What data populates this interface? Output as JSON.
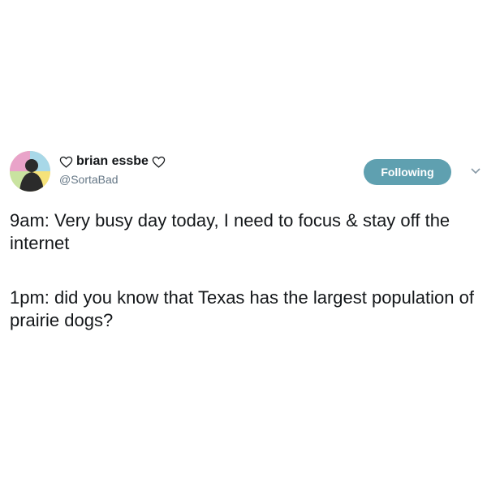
{
  "tweet": {
    "display_name": "brian essbe",
    "handle": "@SortaBad",
    "follow_button_label": "Following",
    "text_lines": [
      "9am: Very busy day today, I need to focus & stay off the internet",
      "1pm: did you know that Texas has the largest population of prairie dogs?"
    ],
    "icons": {
      "name_prefix": "heart-outline-icon",
      "name_suffix": "heart-outline-icon",
      "menu": "chevron-down-icon"
    }
  },
  "colors": {
    "follow_button_bg": "#5fa0b0",
    "handle_text": "#657786",
    "primary_text": "#14171a"
  }
}
